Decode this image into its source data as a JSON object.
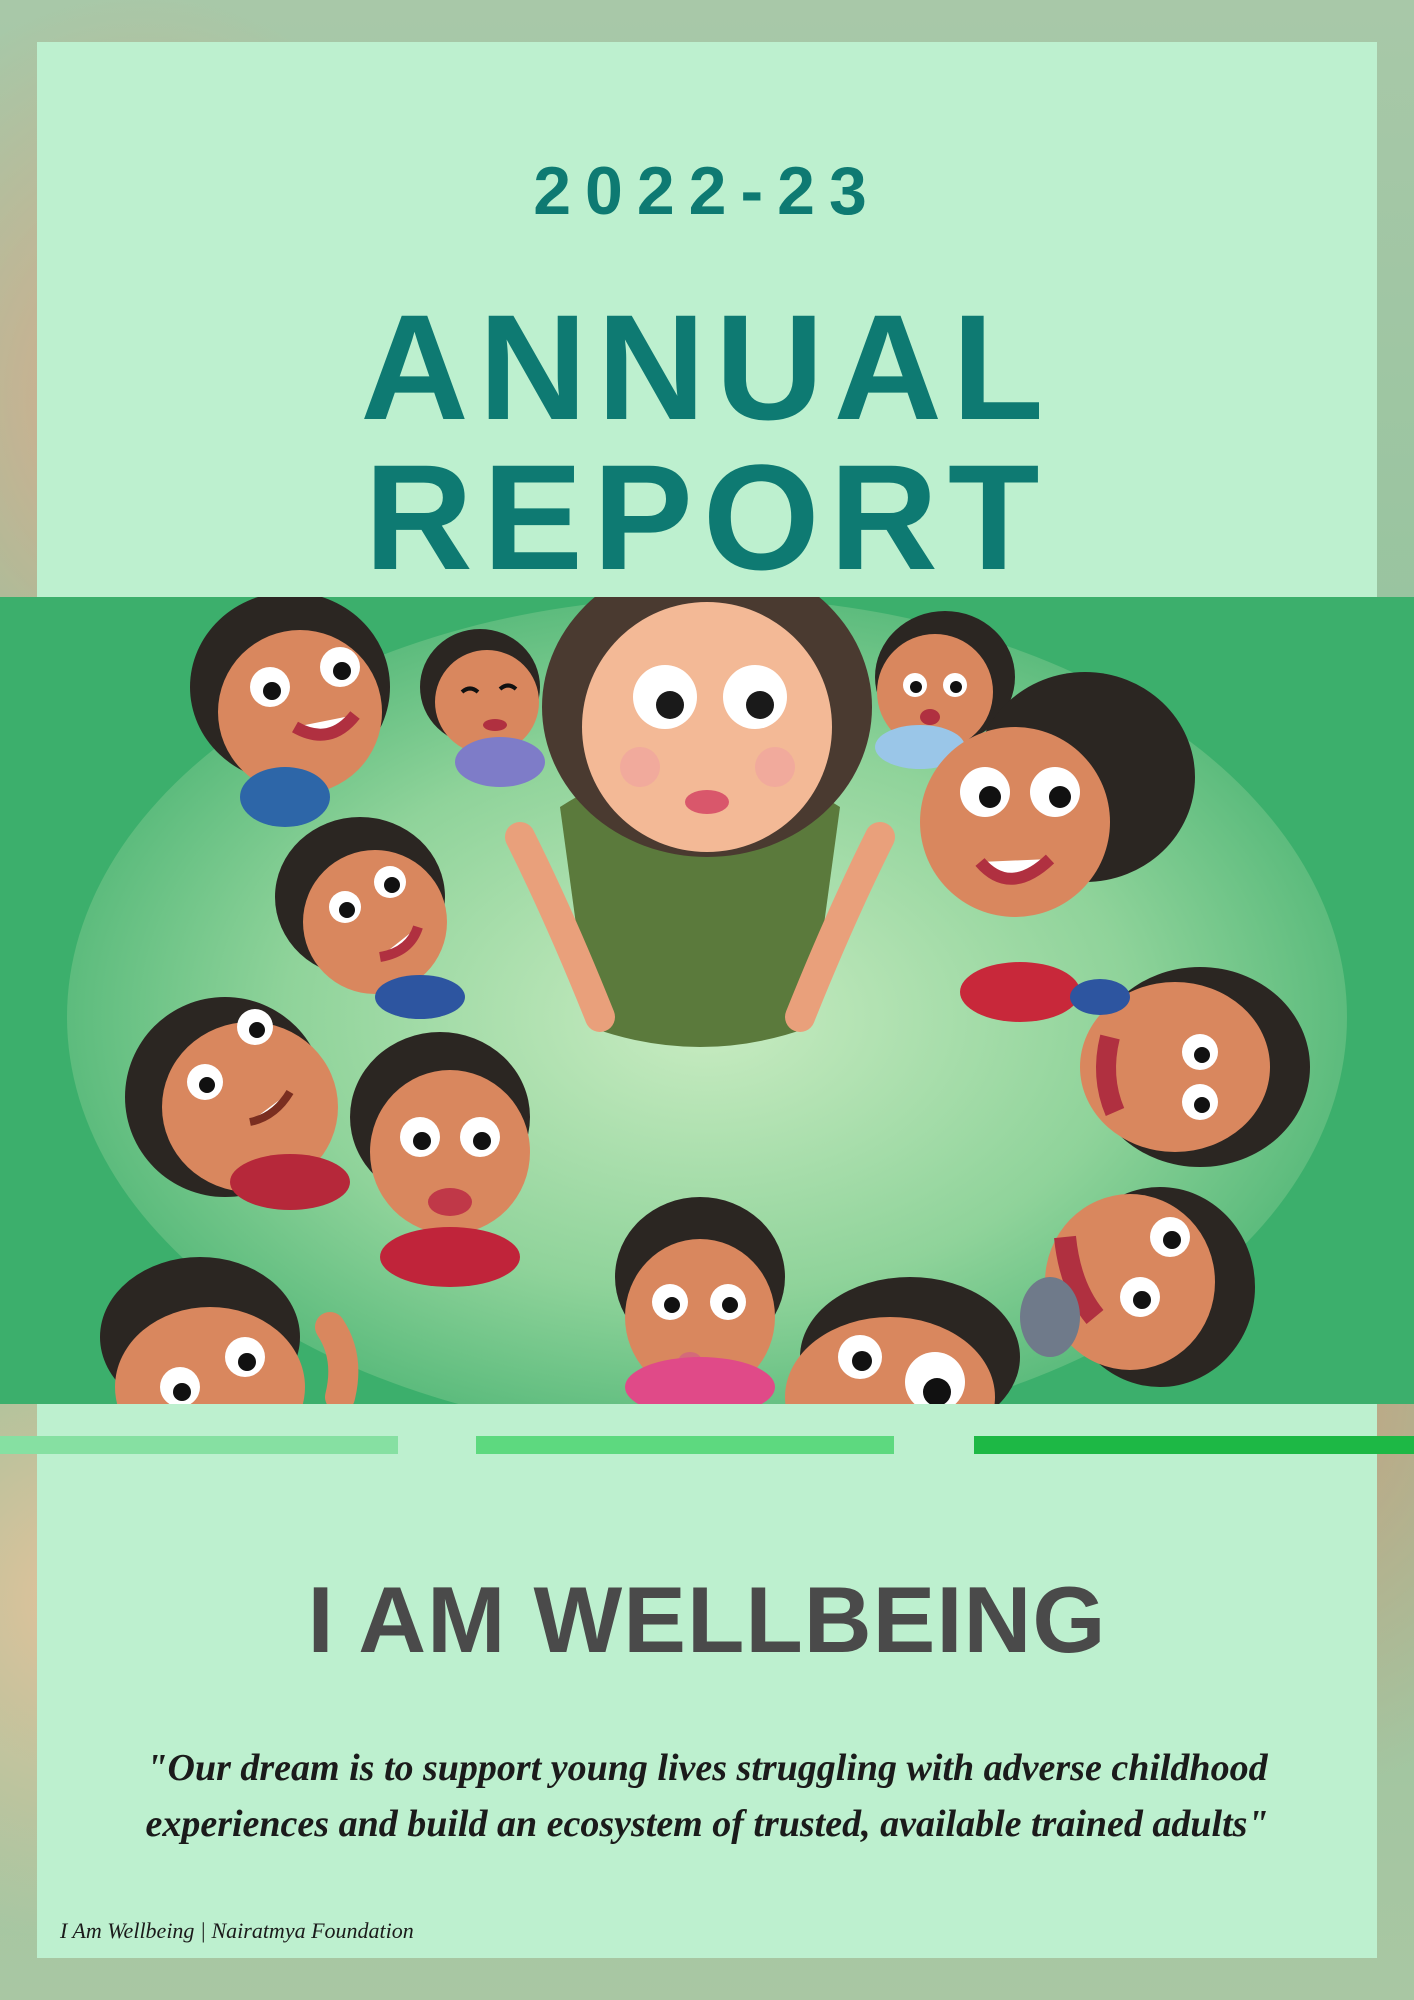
{
  "cover": {
    "year": "2022-23",
    "title_line1": "ANNUAL",
    "title_line2": "REPORT",
    "brand": "I AM WELLBEING",
    "quote_line1": "\"Our dream is to support young lives struggling with adverse childhood",
    "quote_line2": "experiences and build an ecosystem of trusted, available trained adults\"",
    "footer": "I Am Wellbeing | Nairatmya Foundation"
  },
  "colors": {
    "panel": "#bdf0cf",
    "title": "#0e7a72",
    "brand": "#4a4a4a",
    "bar_light": "#86e0a2",
    "bar_mid": "#5dd97f",
    "bar_dark": "#1db845"
  },
  "illustration": {
    "icon": "children-circle-illustration"
  }
}
